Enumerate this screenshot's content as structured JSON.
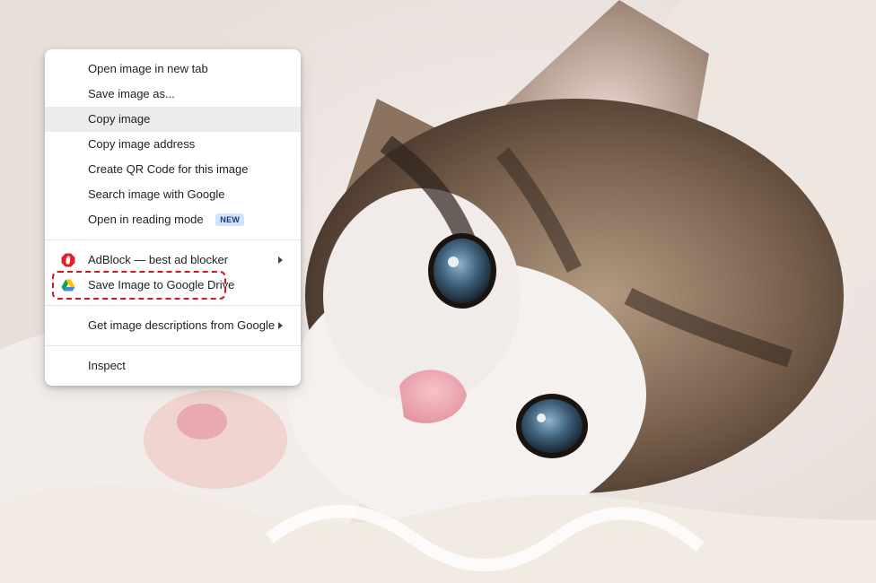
{
  "context_menu": {
    "items": [
      {
        "label": "Open image in new tab"
      },
      {
        "label": "Save image as..."
      },
      {
        "label": "Copy image"
      },
      {
        "label": "Copy image address"
      },
      {
        "label": "Create QR Code for this image"
      },
      {
        "label": "Search image with Google"
      },
      {
        "label": "Open in reading mode",
        "badge": "NEW"
      }
    ],
    "extensions": [
      {
        "label": "AdBlock — best ad blocker",
        "icon": "adblock-icon",
        "has_submenu": true
      },
      {
        "label": "Save Image to Google Drive",
        "icon": "google-drive-icon",
        "highlighted": true
      }
    ],
    "google_item": {
      "label": "Get image descriptions from Google",
      "has_submenu": true
    },
    "inspect": {
      "label": "Inspect"
    },
    "hovered_item": "Copy image"
  },
  "colors": {
    "menu_bg": "#ffffff",
    "hover_bg": "#ececec",
    "highlight_border": "#d2181e",
    "badge_bg": "#d3e3fd",
    "adblock_red": "#e31f26"
  }
}
